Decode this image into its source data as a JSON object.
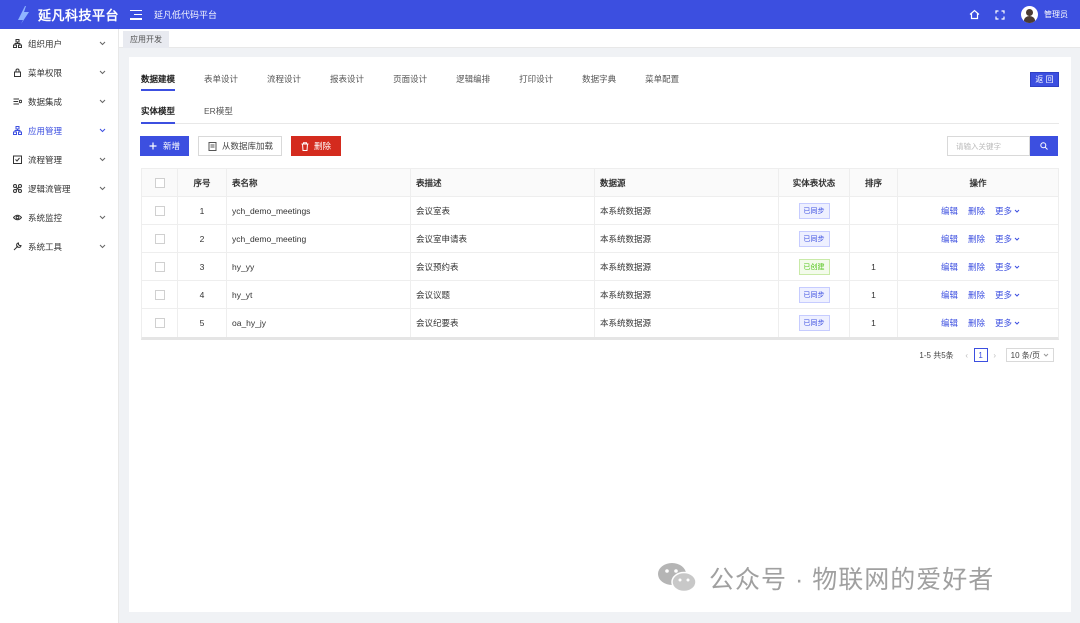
{
  "header": {
    "app_title": "延凡科技平台",
    "platform_name": "延凡低代码平台",
    "user_name": "管理员",
    "accent_color": "#3c4fe0",
    "icons": [
      "menu-fold-icon",
      "home-icon",
      "fullscreen-icon"
    ]
  },
  "sidebar": {
    "items": [
      {
        "label": "组织用户",
        "icon": "org-icon"
      },
      {
        "label": "菜单权限",
        "icon": "lock-icon"
      },
      {
        "label": "数据集成",
        "icon": "data-icon"
      },
      {
        "label": "应用管理",
        "icon": "app-icon",
        "active": true
      },
      {
        "label": "流程管理",
        "icon": "flow-icon"
      },
      {
        "label": "逻辑流管理",
        "icon": "logic-icon"
      },
      {
        "label": "系统监控",
        "icon": "eye-icon"
      },
      {
        "label": "系统工具",
        "icon": "tool-icon"
      }
    ]
  },
  "tabstrip": {
    "current": "应用开发"
  },
  "topnav": {
    "tabs": [
      "数据建模",
      "表单设计",
      "流程设计",
      "报表设计",
      "页面设计",
      "逻辑编排",
      "打印设计",
      "数据字典",
      "菜单配置"
    ],
    "active": "数据建模",
    "back_label": "返 回"
  },
  "subnav": {
    "tabs": [
      "实体模型",
      "ER模型"
    ],
    "active": "实体模型"
  },
  "toolbar": {
    "add_label": "新增",
    "load_label": "从数据库加载",
    "delete_label": "删除"
  },
  "search": {
    "placeholder": "请输入关键字"
  },
  "table": {
    "headers": {
      "no": "序号",
      "name": "表名称",
      "desc": "表描述",
      "source": "数据源",
      "status": "实体表状态",
      "sort": "排序",
      "ops": "操作"
    },
    "rows": [
      {
        "no": "1",
        "name": "ych_demo_meetings",
        "desc": "会议室表",
        "source": "本系统数据源",
        "status": "已同步",
        "status_kind": "sync",
        "sort": ""
      },
      {
        "no": "2",
        "name": "ych_demo_meeting",
        "desc": "会议室申请表",
        "source": "本系统数据源",
        "status": "已同步",
        "status_kind": "sync",
        "sort": ""
      },
      {
        "no": "3",
        "name": "hy_yy",
        "desc": "会议预约表",
        "source": "本系统数据源",
        "status": "已创建",
        "status_kind": "created",
        "sort": "1"
      },
      {
        "no": "4",
        "name": "hy_yt",
        "desc": "会议议题",
        "source": "本系统数据源",
        "status": "已同步",
        "status_kind": "sync",
        "sort": "1"
      },
      {
        "no": "5",
        "name": "oa_hy_jy",
        "desc": "会议纪要表",
        "source": "本系统数据源",
        "status": "已同步",
        "status_kind": "sync",
        "sort": "1"
      }
    ],
    "ops": {
      "edit": "编辑",
      "delete": "删除",
      "more": "更多"
    }
  },
  "pagination": {
    "total_text": "1-5 共5条",
    "current_page": "1",
    "page_size": "10 条/页"
  },
  "watermark": {
    "text": "公众号 · 物联网的爱好者"
  }
}
